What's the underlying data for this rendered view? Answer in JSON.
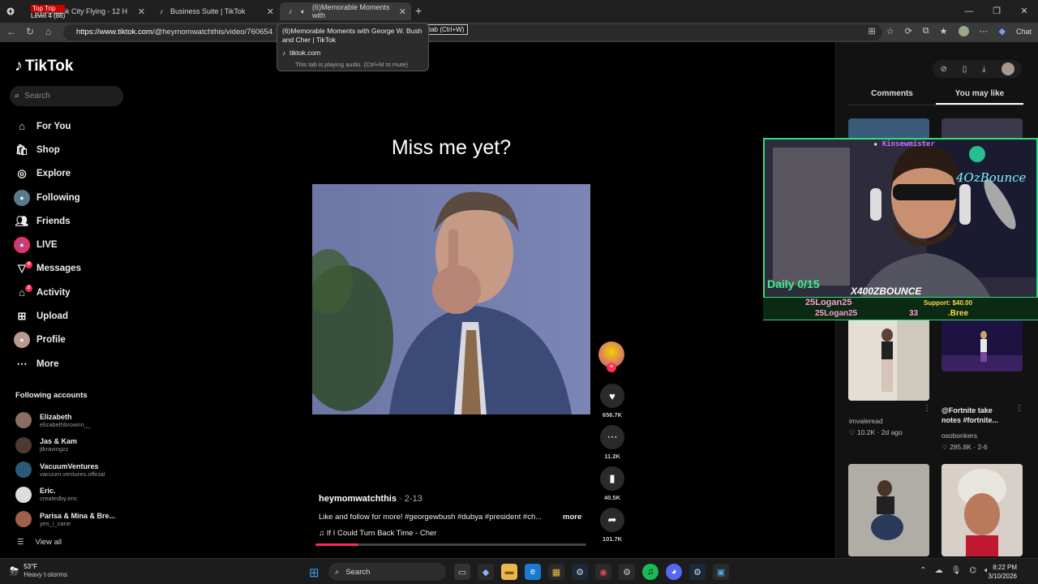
{
  "browser": {
    "tabs": [
      {
        "title": "Cyberpunk City Flying - 12 H",
        "icon": "app-icon"
      },
      {
        "title": "Business Suite | TikTok",
        "icon": "tiktok-icon"
      },
      {
        "title": "(6)Memorable Moments with",
        "icon": "tiktok-icon",
        "active": true
      }
    ],
    "overlay_line1": "Top Trip",
    "overlay_line2": "Level 4 (86)",
    "url_host": "https://www.tiktok.com",
    "url_path": "/@heymomwatchthis/video/760654",
    "chat_label": "Chat",
    "tooltip": {
      "title": "(6)Memorable Moments with George W. Bush and Cher | TikTok",
      "domain": "tiktok.com",
      "note": "This tab is playing audio. (Ctrl+M to mute)"
    },
    "close_tip": "tab (Ctrl+W)"
  },
  "sidebar": {
    "logo_text": "TikTok",
    "search_placeholder": "Search",
    "nav": [
      {
        "label": "For You",
        "icon": "home-icon"
      },
      {
        "label": "Shop",
        "icon": "shop-icon"
      },
      {
        "label": "Explore",
        "icon": "explore-icon"
      },
      {
        "label": "Following",
        "icon": "following-icon"
      },
      {
        "label": "Friends",
        "icon": "friends-icon"
      },
      {
        "label": "LIVE",
        "icon": "live-icon"
      },
      {
        "label": "Messages",
        "icon": "messages-icon",
        "badge": "4"
      },
      {
        "label": "Activity",
        "icon": "activity-icon",
        "badge": "2"
      },
      {
        "label": "Upload",
        "icon": "upload-icon"
      },
      {
        "label": "Profile",
        "icon": "profile-icon"
      },
      {
        "label": "More",
        "icon": "more-icon"
      }
    ],
    "following_title": "Following accounts",
    "following": [
      {
        "name": "Elizabeth",
        "handle": "elizabethbrownn__"
      },
      {
        "name": "Jas & Kam",
        "handle": "jtkravingzz"
      },
      {
        "name": "VacuumVentures",
        "handle": "vacuum.ventures.official"
      },
      {
        "name": "Eric.",
        "handle": "createdby.eric"
      },
      {
        "name": "Parisa & Mina & Bre...",
        "handle": "yes_i_cane"
      }
    ],
    "view_all": "View all"
  },
  "video": {
    "caption": "Miss me yet?",
    "author": "heymomwatchthis",
    "date": " · 2-13",
    "description": "Like and follow for more! #georgewbush #dubya #president #ch...",
    "more": "more",
    "music": "If I Could Turn Back Time - Cher",
    "progress": 0.16
  },
  "actions": {
    "likes": "656.7K",
    "comments": "11.2K",
    "saves": "40.5K",
    "shares": "101.7K"
  },
  "right_panel": {
    "tabs": [
      "Comments",
      "You may like"
    ],
    "items": [
      {
        "caption": "",
        "author": "imvaleread",
        "meta": "♡ 10.2K · 2d ago"
      },
      {
        "caption": "@Fortnite take notes #fortnite...",
        "author": "osobonkers",
        "meta": "♡ 285.8K · 2-6"
      }
    ]
  },
  "stream": {
    "streamer": "Kinsewmister",
    "daily": "Daily 0/15",
    "name": "X400ZBOUNCE",
    "neon_text": "4OzBounce",
    "ticker_1": "25Logan25",
    "ticker_2": "25Logan25",
    "ticker_num": "33",
    "support": "Support: $40.00",
    "bree": ".Bree"
  },
  "taskbar": {
    "temp": "53°F",
    "weather": "Heavy t-storms",
    "search": "Search",
    "time": "8:22 PM",
    "date": "3/10/2026"
  }
}
